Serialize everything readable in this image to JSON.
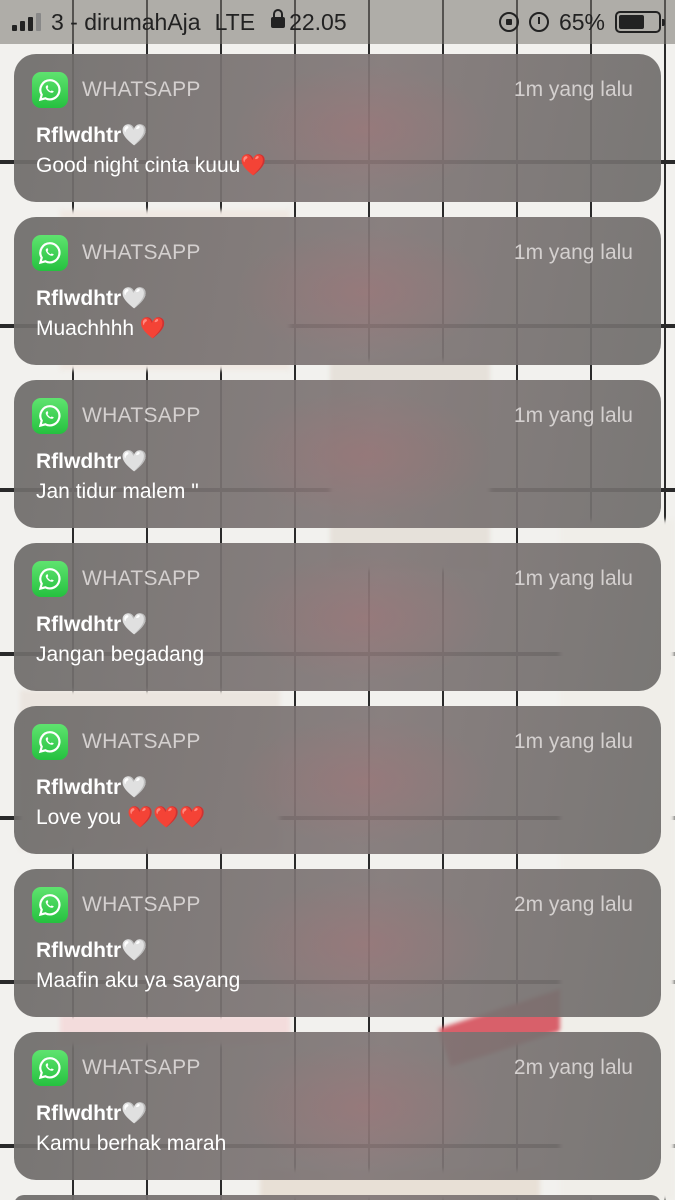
{
  "status_bar": {
    "carrier": "3 - dirumahAja",
    "network": "LTE",
    "time": "22.05",
    "battery": "65%",
    "battery_level": 0.65,
    "icons": [
      "signal-icon",
      "lock-icon",
      "orientation-lock-icon",
      "alarm-icon",
      "battery-icon"
    ]
  },
  "notifications": [
    {
      "app": "WHATSAPP",
      "time": "1m yang lalu",
      "sender": "Rflwdhtr🤍",
      "message": "Good night cinta kuuu❤️"
    },
    {
      "app": "WHATSAPP",
      "time": "1m yang lalu",
      "sender": "Rflwdhtr🤍",
      "message": "Muachhhh ❤️"
    },
    {
      "app": "WHATSAPP",
      "time": "1m yang lalu",
      "sender": "Rflwdhtr🤍",
      "message": "Jan tidur malem \""
    },
    {
      "app": "WHATSAPP",
      "time": "1m yang lalu",
      "sender": "Rflwdhtr🤍",
      "message": "Jangan begadang"
    },
    {
      "app": "WHATSAPP",
      "time": "1m yang lalu",
      "sender": "Rflwdhtr🤍",
      "message": "Love you ❤️❤️❤️"
    },
    {
      "app": "WHATSAPP",
      "time": "2m yang lalu",
      "sender": "Rflwdhtr🤍",
      "message": "Maafin aku ya sayang"
    },
    {
      "app": "WHATSAPP",
      "time": "2m yang lalu",
      "sender": "Rflwdhtr🤍",
      "message": "Kamu berhak marah"
    }
  ],
  "colors": {
    "whatsapp_green": "#25c13f",
    "notification_bg": "#7a7674",
    "status_bar_bg": "#8a8682"
  }
}
